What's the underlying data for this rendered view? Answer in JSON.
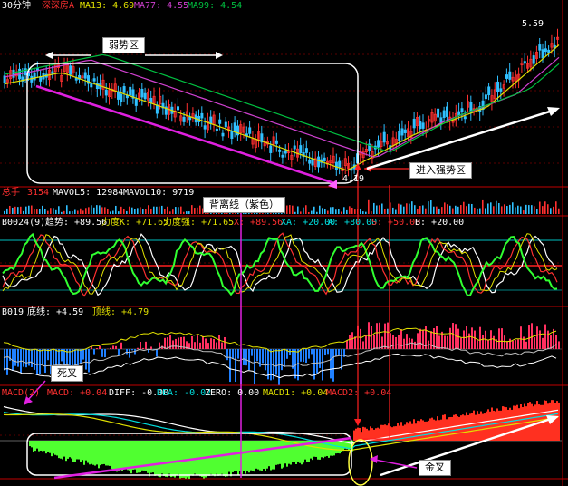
{
  "colors": {
    "up": "#ff3030",
    "down": "#30c0ff",
    "ma13": "#e0e000",
    "ma77": "#d040d0",
    "ma99": "#00c040",
    "volume": "#ffffff",
    "axis": "#c00000"
  },
  "main_panel": {
    "timeframe": "30分钟",
    "name": "深深房A",
    "ma13": "MA13: 4.69",
    "ma77": "MA77: 4.55",
    "ma99": "MA99: 4.54",
    "price_high": "5.59",
    "price_low": "4.19"
  },
  "volume_panel": {
    "name": "总手",
    "value": "3154",
    "mavol5": "MAVOL5: 12984",
    "mavol10": "MAVOL10: 9719"
  },
  "trend_panel": {
    "name": "B0024(9)",
    "qushi": "趋势: +89.56",
    "lidu_k": "力度K: +71.65",
    "lidu_qiang": "力度强: +71.65",
    "x": "X: +89.56",
    "xa": "XA: +20.00",
    "a": "A: +80.00",
    "s": "S: +50.00",
    "b": "B: +20.00"
  },
  "b019_panel": {
    "name": "B019",
    "dixian": "底线: +4.59",
    "dingxian": "顶线: +4.79"
  },
  "macd_panel": {
    "name": "MACD(2)",
    "macd": "MACD: +0.04",
    "diff": "DIFF: -0.00",
    "dea": "DEA: -0.02",
    "zero": "ZERO: 0.00",
    "macd1": "MACD1: +0.04",
    "macd2": "MACD2: +0.04"
  },
  "annotations": {
    "weak_zone": "弱势区",
    "strong_zone": "进入强势区",
    "bias_line": "背离线（紫色）",
    "death_cross": "死叉",
    "golden_cross": "金叉"
  }
}
